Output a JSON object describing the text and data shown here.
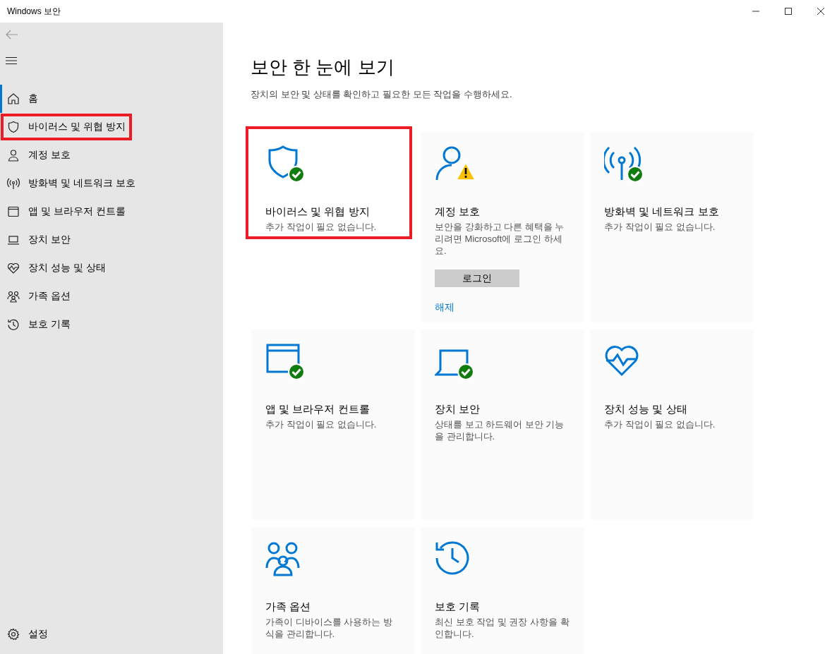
{
  "window": {
    "title": "Windows 보안"
  },
  "sidebar": {
    "items": [
      {
        "label": "홈",
        "selected": true,
        "highlighted": false
      },
      {
        "label": "바이러스 및 위협 방지",
        "selected": false,
        "highlighted": true
      },
      {
        "label": "계정 보호",
        "selected": false,
        "highlighted": false
      },
      {
        "label": "방화벽 및 네트워크 보호",
        "selected": false,
        "highlighted": false
      },
      {
        "label": "앱 및 브라우저 컨트롤",
        "selected": false,
        "highlighted": false
      },
      {
        "label": "장치 보안",
        "selected": false,
        "highlighted": false
      },
      {
        "label": "장치 성능 및 상태",
        "selected": false,
        "highlighted": false
      },
      {
        "label": "가족 옵션",
        "selected": false,
        "highlighted": false
      },
      {
        "label": "보호 기록",
        "selected": false,
        "highlighted": false
      }
    ],
    "settings": {
      "label": "설정"
    }
  },
  "main": {
    "title": "보안 한 눈에 보기",
    "subtitle": "장치의 보안 및 상태를 확인하고 필요한 모든 작업을 수행하세요.",
    "cards": [
      {
        "kind": "ok",
        "title": "바이러스 및 위협 방지",
        "description": "추가 작업이 필요 없습니다.",
        "highlighted": true
      },
      {
        "kind": "warning",
        "title": "계정 보호",
        "description": "보안을 강화하고 다른 혜택을 누리려면 Microsoft에 로그인 하세요.",
        "button": "로그인",
        "link": "해제",
        "highlighted": false
      },
      {
        "kind": "ok",
        "title": "방화벽 및 네트워크 보호",
        "description": "추가 작업이 필요 없습니다.",
        "highlighted": false
      },
      {
        "kind": "ok",
        "title": "앱 및 브라우저 컨트롤",
        "description": "추가 작업이 필요 없습니다.",
        "highlighted": false
      },
      {
        "kind": "ok",
        "title": "장치 보안",
        "description": "상태를 보고 하드웨어 보안 기능을 관리합니다.",
        "highlighted": false
      },
      {
        "kind": "plain",
        "title": "장치 성능 및 상태",
        "description": "추가 작업이 필요 없습니다.",
        "highlighted": false
      },
      {
        "kind": "plain",
        "title": "가족 옵션",
        "description": "가족이 디바이스를 사용하는 방식을 관리합니다.",
        "highlighted": false
      },
      {
        "kind": "plain",
        "title": "보호 기록",
        "description": "최신 보호 작업 및 권장 사항을 확인합니다.",
        "highlighted": false
      }
    ]
  }
}
